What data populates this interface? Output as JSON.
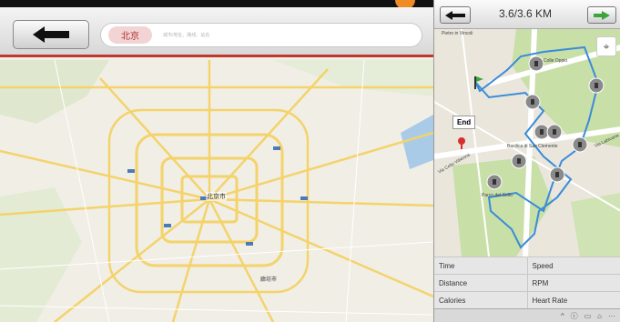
{
  "left_app": {
    "city": "北京",
    "search_placeholder": "城市/地址、路线、站名",
    "map": {
      "center_city": "北京市",
      "secondary_city": "廊坊市"
    }
  },
  "right_app": {
    "distance_title": "3.6/3.6 KM",
    "map": {
      "end_label": "End",
      "labels": [
        "Pietro in Vincoli",
        "Colle Oppio",
        "Basilica di San Clemente",
        "Parco del Celio",
        "Via Celio Vibenna",
        "Via Labicana"
      ]
    },
    "stats": [
      [
        "Time",
        "Speed"
      ],
      [
        "Distance",
        "RPM"
      ],
      [
        "Calories",
        "Heart Rate"
      ]
    ],
    "bottom_bar": [
      "^",
      "ⓘ",
      "▭",
      "⌂",
      "···"
    ]
  },
  "colors": {
    "accent_red": "#c0392b",
    "route_blue": "#3b8bd9",
    "park_green": "#c8dfa8",
    "road_yellow": "#f3d36a"
  }
}
